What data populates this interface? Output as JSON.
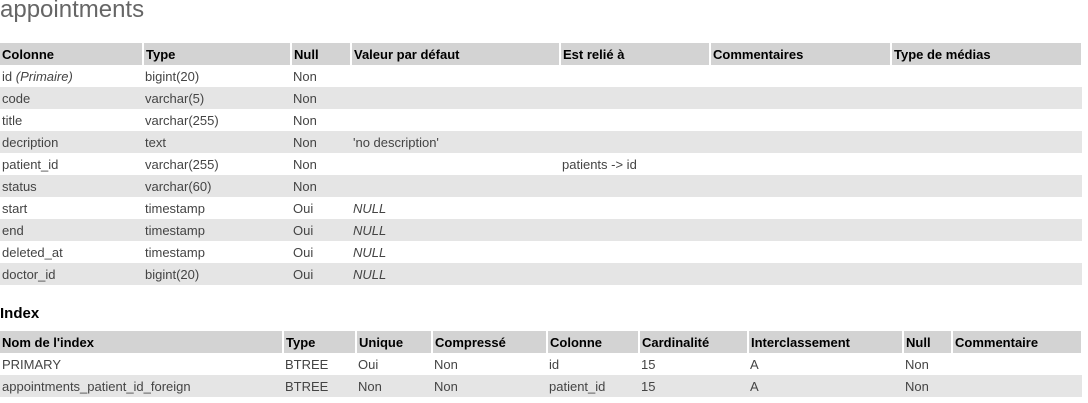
{
  "page_title": "appointments",
  "columns_table": {
    "headers": [
      "Colonne",
      "Type",
      "Null",
      "Valeur par défaut",
      "Est relié à",
      "Commentaires",
      "Type de médias"
    ],
    "rows": [
      {
        "name": "id",
        "name_suffix": "(Primaire)",
        "type": "bigint(20)",
        "null": "Non",
        "default": "",
        "default_italic": false,
        "link": "",
        "comment": "",
        "media": ""
      },
      {
        "name": "code",
        "name_suffix": "",
        "type": "varchar(5)",
        "null": "Non",
        "default": "",
        "default_italic": false,
        "link": "",
        "comment": "",
        "media": ""
      },
      {
        "name": "title",
        "name_suffix": "",
        "type": "varchar(255)",
        "null": "Non",
        "default": "",
        "default_italic": false,
        "link": "",
        "comment": "",
        "media": ""
      },
      {
        "name": "decription",
        "name_suffix": "",
        "type": "text",
        "null": "Non",
        "default": "'no description'",
        "default_italic": false,
        "link": "",
        "comment": "",
        "media": ""
      },
      {
        "name": "patient_id",
        "name_suffix": "",
        "type": "varchar(255)",
        "null": "Non",
        "default": "",
        "default_italic": false,
        "link": "patients -> id",
        "comment": "",
        "media": ""
      },
      {
        "name": "status",
        "name_suffix": "",
        "type": "varchar(60)",
        "null": "Non",
        "default": "",
        "default_italic": false,
        "link": "",
        "comment": "",
        "media": ""
      },
      {
        "name": "start",
        "name_suffix": "",
        "type": "timestamp",
        "null": "Oui",
        "default": "NULL",
        "default_italic": true,
        "link": "",
        "comment": "",
        "media": ""
      },
      {
        "name": "end",
        "name_suffix": "",
        "type": "timestamp",
        "null": "Oui",
        "default": "NULL",
        "default_italic": true,
        "link": "",
        "comment": "",
        "media": ""
      },
      {
        "name": "deleted_at",
        "name_suffix": "",
        "type": "timestamp",
        "null": "Oui",
        "default": "NULL",
        "default_italic": true,
        "link": "",
        "comment": "",
        "media": ""
      },
      {
        "name": "doctor_id",
        "name_suffix": "",
        "type": "bigint(20)",
        "null": "Oui",
        "default": "NULL",
        "default_italic": true,
        "link": "",
        "comment": "",
        "media": ""
      }
    ]
  },
  "index_section": {
    "title": "Index",
    "headers": [
      "Nom de l'index",
      "Type",
      "Unique",
      "Compressé",
      "Colonne",
      "Cardinalité",
      "Interclassement",
      "Null",
      "Commentaire"
    ],
    "rows": [
      [
        "PRIMARY",
        "BTREE",
        "Oui",
        "Non",
        "id",
        "15",
        "A",
        "Non",
        ""
      ],
      [
        "appointments_patient_id_foreign",
        "BTREE",
        "Non",
        "Non",
        "patient_id",
        "15",
        "A",
        "Non",
        ""
      ]
    ]
  }
}
